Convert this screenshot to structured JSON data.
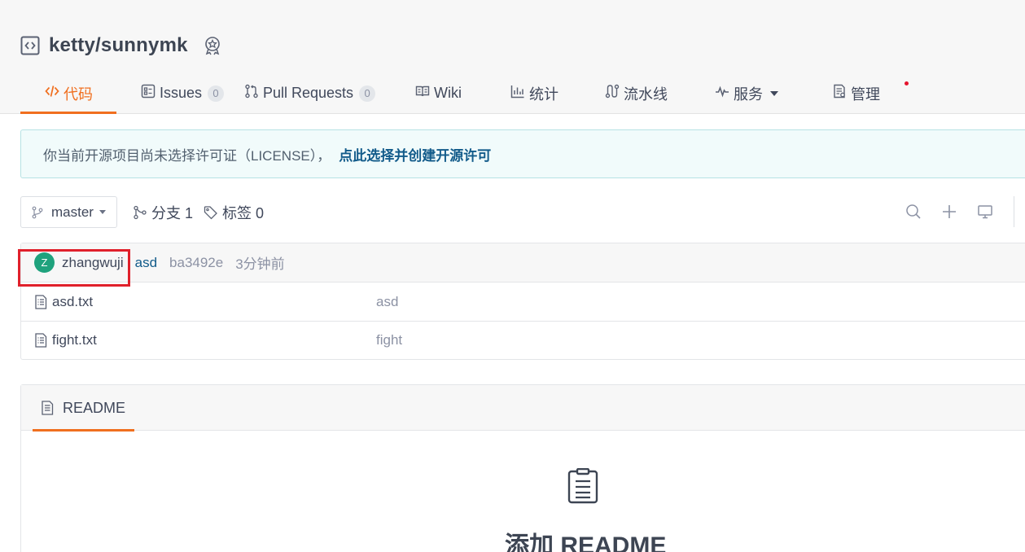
{
  "repo": {
    "title": "ketty/sunnymk",
    "icon": "code-box-icon",
    "badge_icon": "award-badge-icon"
  },
  "tabs": [
    {
      "label": "代码",
      "icon": "code-icon",
      "active": true
    },
    {
      "label": "Issues",
      "icon": "issues-icon",
      "count": "0"
    },
    {
      "label": "Pull Requests",
      "icon": "pull-request-icon",
      "count": "0"
    },
    {
      "label": "Wiki",
      "icon": "book-icon"
    },
    {
      "label": "统计",
      "icon": "bar-chart-icon"
    },
    {
      "label": "流水线",
      "icon": "pipeline-icon"
    },
    {
      "label": "服务",
      "icon": "pulse-icon"
    },
    {
      "label": "管理",
      "icon": "settings-doc-icon"
    }
  ],
  "notice": {
    "text": "你当前开源项目尚未选择许可证（LICENSE），",
    "link": "点此选择并创建开源许可"
  },
  "branch": {
    "current": "master",
    "branches_label": "分支 1",
    "tags_label": "标签 0"
  },
  "commit": {
    "avatar_initial": "Z",
    "author": "zhangwuji",
    "message": "asd",
    "sha": "ba3492e",
    "time": "3分钟前"
  },
  "files": [
    {
      "name": "asd.txt",
      "message": "asd"
    },
    {
      "name": "fight.txt",
      "message": "fight"
    }
  ],
  "readme": {
    "tab_label": "README",
    "add_label": "添加 README"
  },
  "colors": {
    "accent": "#f06f1f",
    "link": "#125b8a",
    "avatar": "#1fa27d",
    "highlight": "#e0202b",
    "notification_dot": "#e5142d"
  }
}
